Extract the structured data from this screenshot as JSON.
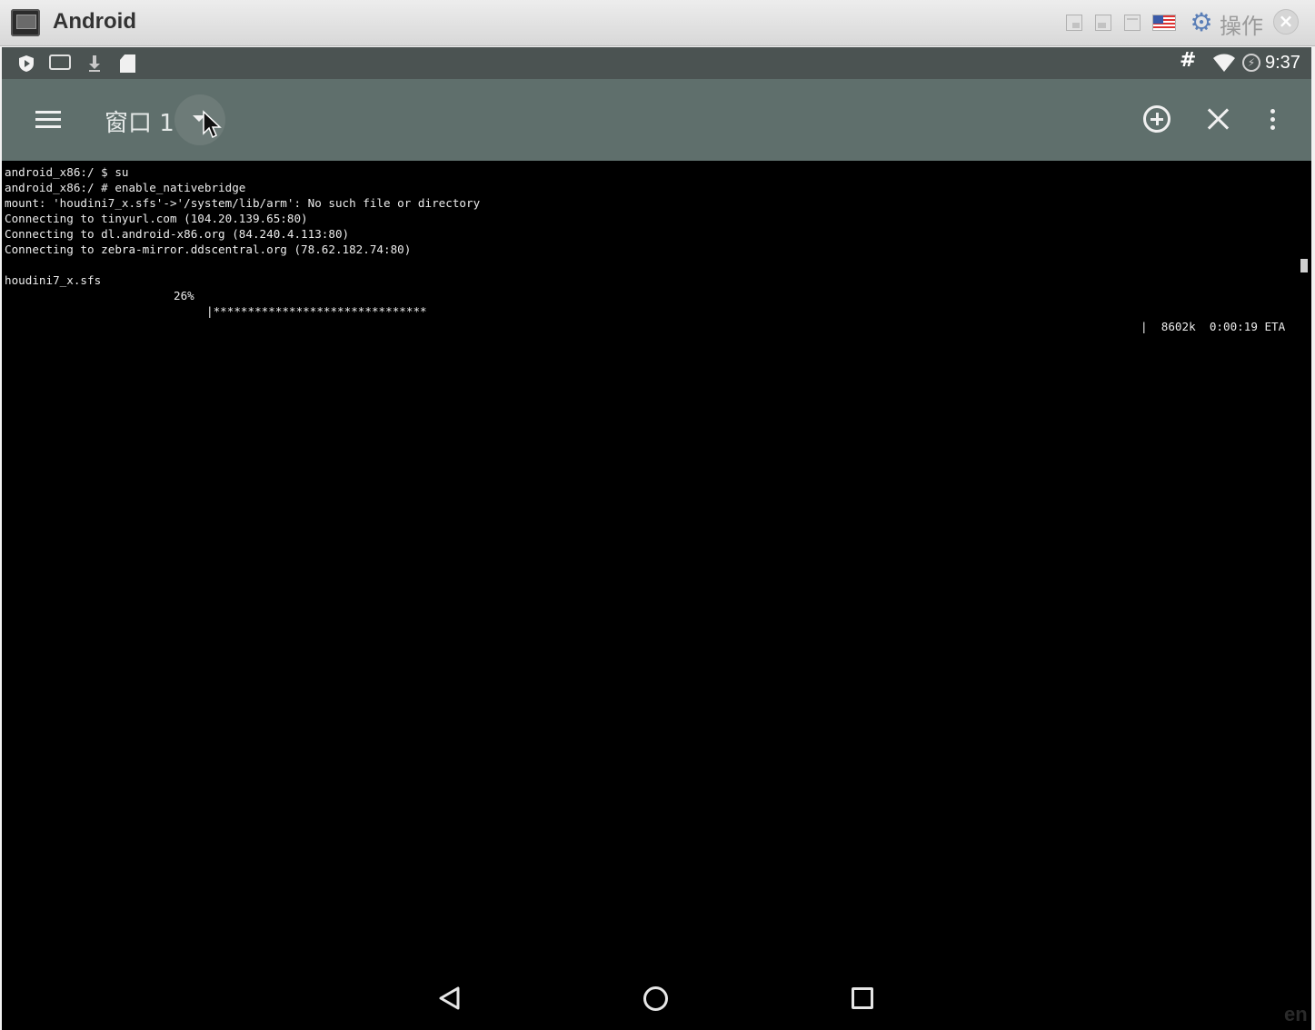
{
  "window": {
    "title": "Android",
    "action_label": "操作",
    "icons": [
      "minimize-icon",
      "restore-icon",
      "maximize-icon",
      "us-flag-icon",
      "gear-icon",
      "close-icon"
    ]
  },
  "status_bar": {
    "left_icons": [
      "shield-icon",
      "debug-icon",
      "download-icon",
      "sdcard-icon"
    ],
    "hash": "#",
    "right_icons": [
      "wifi-icon",
      "battery-charging-icon"
    ],
    "time": "9:37"
  },
  "toolbar": {
    "tab_label": "窗口 1",
    "icons": [
      "menu-icon",
      "dropdown-arrow-icon",
      "add-tab-icon",
      "close-tab-icon",
      "more-icon"
    ]
  },
  "terminal": {
    "lines": [
      "android_x86:/ $ su",
      "android_x86:/ # enable_nativebridge",
      "mount: 'houdini7_x.sfs'->'/system/lib/arm': No such file or directory",
      "Connecting to tinyurl.com (104.20.139.65:80)",
      "Connecting to dl.android-x86.org (84.240.4.113:80)",
      "Connecting to zebra-mirror.ddscentral.org (78.62.182.74:80)"
    ],
    "progress": {
      "file": "houdini7_x.sfs",
      "percent": "26%",
      "bar": "|*******************************",
      "end": "|  8602k  0:00:19 ETA",
      "fraction": 0.26
    }
  },
  "nav_bar": {
    "icons": [
      "back-icon",
      "home-icon",
      "recents-icon"
    ],
    "ime": "en"
  },
  "colors": {
    "status_bar": "#4b5352",
    "toolbar": "#5f6f6c",
    "terminal_bg": "#000000",
    "terminal_fg": "#ececec"
  }
}
